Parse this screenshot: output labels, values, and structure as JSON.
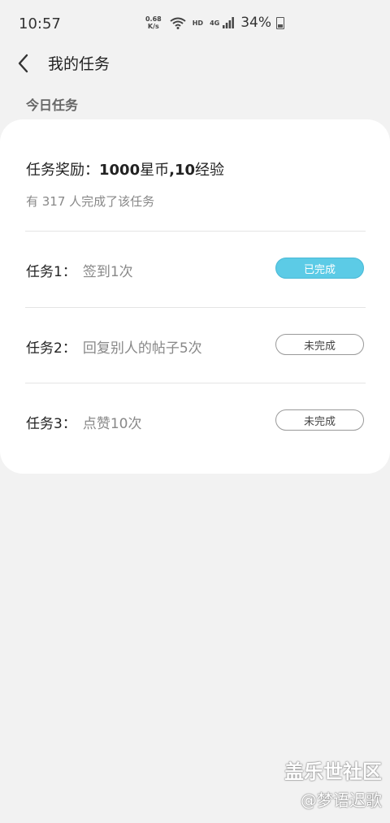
{
  "status_bar": {
    "time": "10:57",
    "net_speed_value": "0.68",
    "net_speed_unit": "K/s",
    "hd_label": "HD",
    "network_type": "4G",
    "battery": "34%"
  },
  "header": {
    "title": "我的任务"
  },
  "section": {
    "title": "今日任务"
  },
  "card": {
    "reward_prefix": "任务奖励：",
    "reward_coins_num": "1000",
    "reward_coins_unit": "星币",
    "reward_sep": ",",
    "reward_exp_num": "10",
    "reward_exp_unit": "经验",
    "completion_text": "有 317 人完成了该任务",
    "tasks": [
      {
        "index": "任务1：",
        "desc": "签到1次",
        "status": "已完成",
        "done": true
      },
      {
        "index": "任务2：",
        "desc": "回复别人的帖子5次",
        "status": "未完成",
        "done": false
      },
      {
        "index": "任务3：",
        "desc": "点赞10次",
        "status": "未完成",
        "done": false
      }
    ]
  },
  "watermark": {
    "line1": "盖乐世社区",
    "line2": "@梦语迟歌"
  },
  "colors": {
    "accent": "#5ccbe6",
    "background": "#f2f2f2",
    "card": "#ffffff"
  }
}
